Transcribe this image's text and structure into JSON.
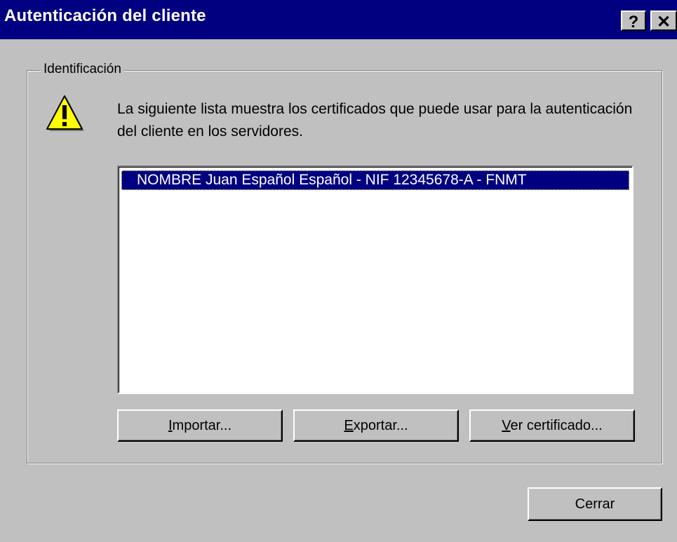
{
  "window": {
    "title": "Autenticación del cliente",
    "help_label": "?",
    "close_label": "✕"
  },
  "group": {
    "legend": "Identificación",
    "icon": "warning-icon",
    "message": "La siguiente lista muestra los certificados que puede usar para la autenticación del cliente en los servidores."
  },
  "certificates": {
    "items": [
      "NOMBRE Juan Español Español - NIF 12345678-A - FNMT"
    ],
    "selected_index": 0
  },
  "buttons": {
    "importar": {
      "mnemonic": "I",
      "rest": "mportar..."
    },
    "exportar": {
      "mnemonic": "E",
      "rest": "xportar..."
    },
    "ver": {
      "mnemonic": "V",
      "rest": "er certificado..."
    },
    "cerrar": "Cerrar"
  },
  "colors": {
    "titlebar": "#000080",
    "face": "#c0c0c0",
    "selection": "#000080",
    "warning_fill": "#ffff00"
  }
}
